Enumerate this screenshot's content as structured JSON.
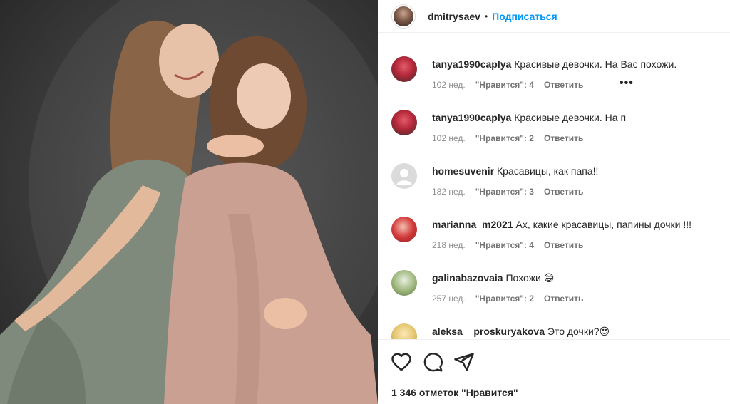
{
  "post": {
    "owner": "dmitrysaev",
    "separator": "•",
    "follow_label": "Подписаться"
  },
  "comments": [
    {
      "user": "tanya1990caplya",
      "text": "Красивые девочки. На Вас похожи.",
      "age": "102 нед.",
      "likes": "\"Нравится\": 4",
      "reply": "Ответить",
      "more": "•••",
      "avatar_color": "#b4283a"
    },
    {
      "user": "tanya1990caplya",
      "text": "Красивые девочки. На п",
      "age": "102 нед.",
      "likes": "\"Нравится\": 2",
      "reply": "Ответить",
      "avatar_color": "#b4283a"
    },
    {
      "user": "homesuvenir",
      "text": "Красавицы, как папа!!",
      "age": "182 нед.",
      "likes": "\"Нравится\": 3",
      "reply": "Ответить",
      "avatar_color": "#dbdbdb"
    },
    {
      "user": "marianna_m2021",
      "text": "Ах, какие красавицы, папины дочки !!!",
      "age": "218 нед.",
      "likes": "\"Нравится\": 4",
      "reply": "Ответить",
      "avatar_color": "#d23a3a"
    },
    {
      "user": "galinabazovaia",
      "text": "Похожи 😄",
      "age": "257 нед.",
      "likes": "\"Нравится\": 2",
      "reply": "Ответить",
      "avatar_color": "#9cb57a"
    },
    {
      "user": "aleksa__proskuryakova",
      "text": "Это дочки?😍",
      "age": "",
      "likes": "",
      "reply": "",
      "avatar_color": "#e2c36c"
    }
  ],
  "actions": {
    "like_icon": "heart-icon",
    "comment_icon": "comment-icon",
    "share_icon": "paper-plane-icon"
  },
  "likes_total": "1 346 отметок \"Нравится\""
}
